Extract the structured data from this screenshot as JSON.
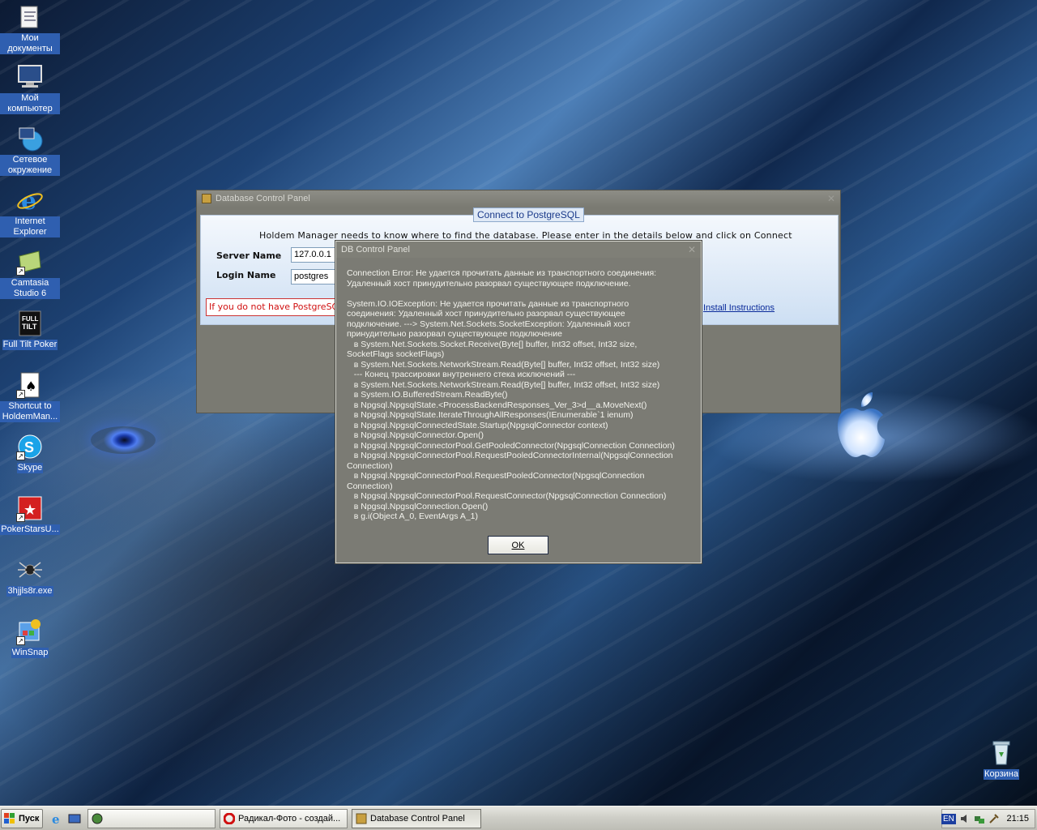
{
  "desktop": {
    "icons": [
      {
        "label": "Мои документы",
        "icon": "documents-folder-icon"
      },
      {
        "label": "Мой компьютер",
        "icon": "computer-icon"
      },
      {
        "label": "Сетевое окружение",
        "icon": "network-icon"
      },
      {
        "label": "Internet Explorer",
        "icon": "internet-explorer-icon"
      },
      {
        "label": "Camtasia Studio 6",
        "icon": "camtasia-icon"
      },
      {
        "label": "Full Tilt Poker",
        "icon": "full-tilt-poker-icon"
      },
      {
        "label": "Shortcut to HoldemMan...",
        "icon": "holdem-manager-icon"
      },
      {
        "label": "Skype",
        "icon": "skype-icon"
      },
      {
        "label": "PokerStarsU...",
        "icon": "pokerstars-icon"
      },
      {
        "label": "3hjjls8r.exe",
        "icon": "spider-exe-icon"
      },
      {
        "label": "WinSnap",
        "icon": "winsnap-icon"
      },
      {
        "label": "Корзина",
        "icon": "recycle-bin-icon"
      }
    ]
  },
  "main_window": {
    "title": "Database Control Panel",
    "tab_label": "Connect to PostgreSQL",
    "intro": "Holdem Manager needs to know where to find the database.  Please enter in the details below and click on Connect",
    "server_label": "Server Name",
    "server_value": "127.0.0.1",
    "login_label": "Login Name",
    "login_value": "postgres",
    "warning": "If you do not have PostgreSQ",
    "install_link": "Install Instructions"
  },
  "error_dialog": {
    "title": "DB Control Panel",
    "message": "Connection Error: Не удается прочитать данные из транспортного соединения:\nУдаленный хост принудительно разорвал существующее подключение.\n\nSystem.IO.IOException: Не удается прочитать данные из транспортного\nсоединения: Удаленный хост принудительно разорвал существующее\nподключение. ---> System.Net.Sockets.SocketException: Удаленный хост\nпринудительно разорвал существующее подключение\n   в System.Net.Sockets.Socket.Receive(Byte[] buffer, Int32 offset, Int32 size,\nSocketFlags socketFlags)\n   в System.Net.Sockets.NetworkStream.Read(Byte[] buffer, Int32 offset, Int32 size)\n   --- Конец трассировки внутреннего стека исключений ---\n   в System.Net.Sockets.NetworkStream.Read(Byte[] buffer, Int32 offset, Int32 size)\n   в System.IO.BufferedStream.ReadByte()\n   в Npgsql.NpgsqlState.<ProcessBackendResponses_Ver_3>d__a.MoveNext()\n   в Npgsql.NpgsqlState.IterateThroughAllResponses(IEnumerable`1 ienum)\n   в Npgsql.NpgsqlConnectedState.Startup(NpgsqlConnector context)\n   в Npgsql.NpgsqlConnector.Open()\n   в Npgsql.NpgsqlConnectorPool.GetPooledConnector(NpgsqlConnection Connection)\n   в Npgsql.NpgsqlConnectorPool.RequestPooledConnectorInternal(NpgsqlConnection\nConnection)\n   в Npgsql.NpgsqlConnectorPool.RequestPooledConnector(NpgsqlConnection\nConnection)\n   в Npgsql.NpgsqlConnectorPool.RequestConnector(NpgsqlConnection Connection)\n   в Npgsql.NpgsqlConnection.Open()\n   в g.i(Object A_0, EventArgs A_1)",
    "ok_label": "OK"
  },
  "taskbar": {
    "start_label": "Пуск",
    "buttons": [
      {
        "label": "",
        "icon": "generic-app-icon"
      },
      {
        "label": "Радикал-Фото - создай...",
        "icon": "opera-icon"
      },
      {
        "label": "Database Control Panel",
        "icon": "database-icon"
      }
    ],
    "tray": {
      "language": "EN",
      "clock": "21:15"
    }
  }
}
